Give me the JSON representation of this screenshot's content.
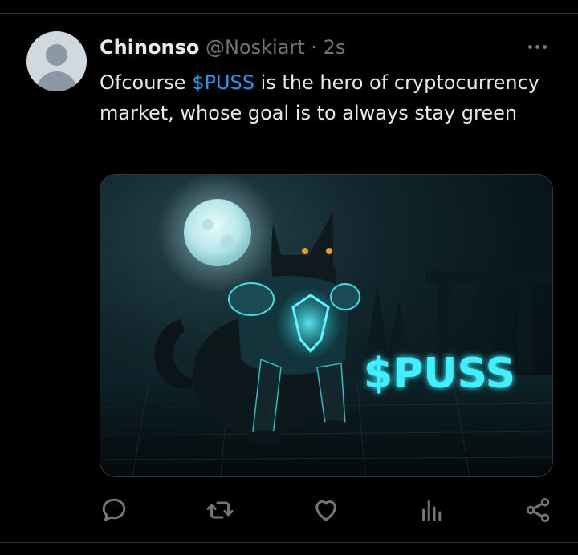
{
  "tweet": {
    "author_name": "Chinonso",
    "author_handle": "@Noskiart",
    "separator": "·",
    "timestamp": "2s",
    "text_before": "Ofcourse ",
    "cashtag": "$PUSS",
    "text_after": " is the hero of cryptocurrency market, whose goal is to always stay green"
  },
  "media": {
    "overlay_text": "$PUSS",
    "accent_color": "#3ff0ff",
    "description_icon": "armored-cat-moon-image"
  },
  "actions": {
    "icons": [
      "reply-icon",
      "retweet-icon",
      "like-icon",
      "views-icon",
      "share-icon"
    ]
  },
  "colors": {
    "background": "#000000",
    "text": "#e7e9ea",
    "muted": "#71767b",
    "link": "#1d9bf0"
  }
}
